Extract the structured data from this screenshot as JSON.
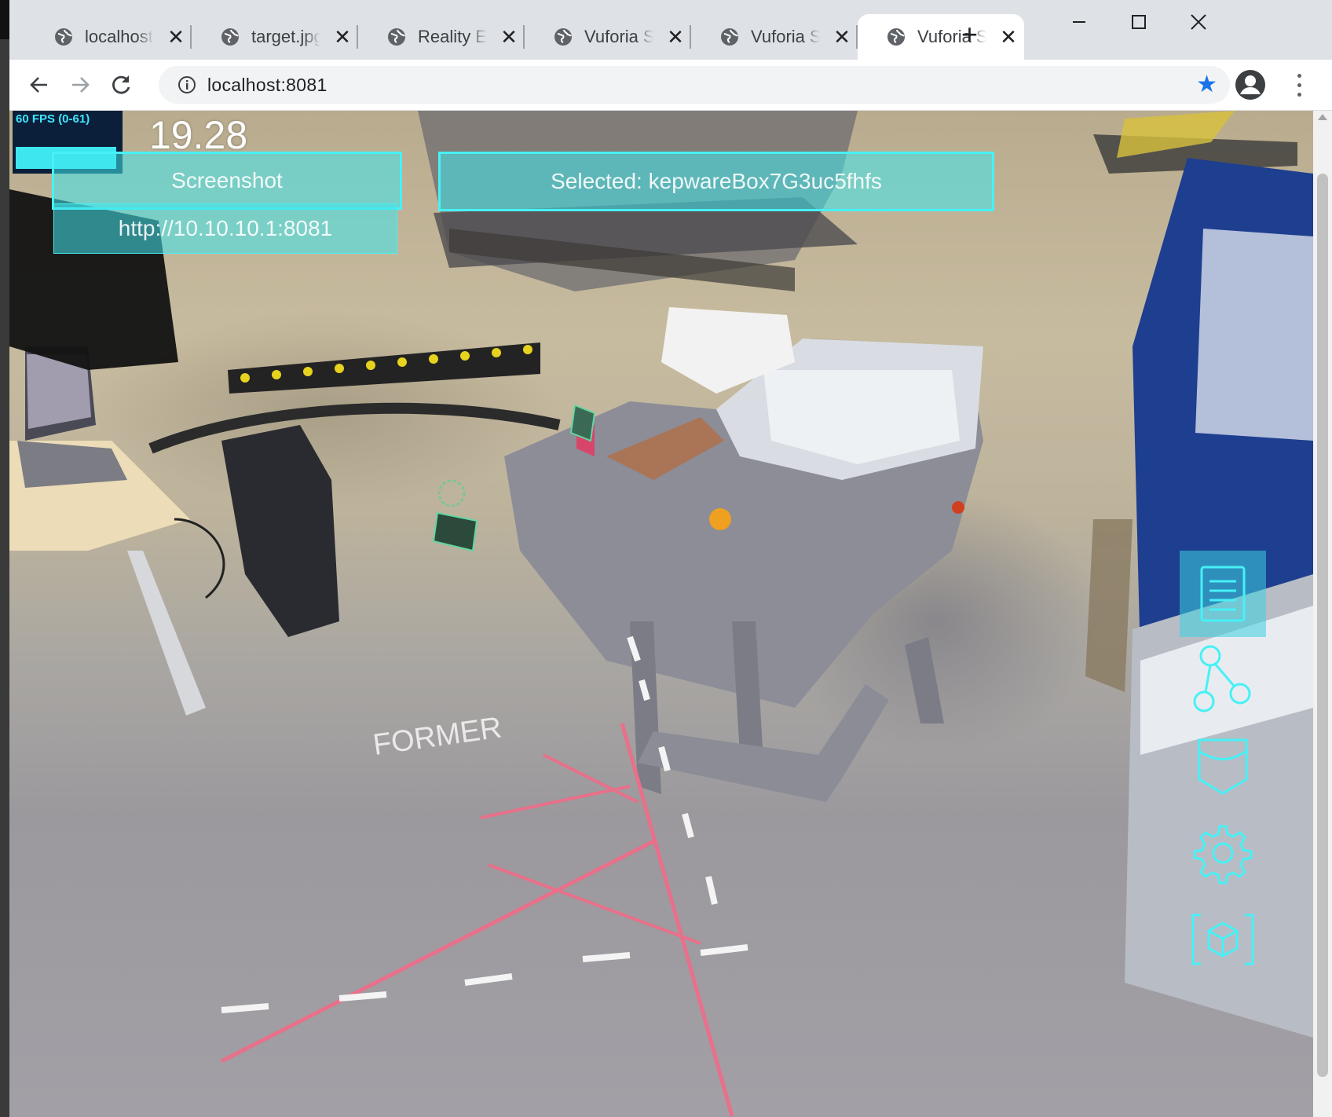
{
  "browser": {
    "tabs": [
      {
        "title": "localhost",
        "active": false
      },
      {
        "title": "target.jpg",
        "active": false
      },
      {
        "title": "Reality Edit",
        "active": false
      },
      {
        "title": "Vuforia Sp",
        "active": false
      },
      {
        "title": "Vuforia Sp",
        "active": false
      },
      {
        "title": "Vuforia Sp",
        "active": true
      }
    ],
    "new_tab_label": "+",
    "address": "localhost:8081",
    "bookmarked": true
  },
  "hud": {
    "fps_label": "60 FPS (0-61)",
    "clock": "19.28",
    "button_top_left": "Screenshot",
    "button_url": "http://10.10.10.1:8081",
    "selected_label": "Selected: kepwareBox7G3uc5fhfs"
  },
  "side_menu": {
    "items": [
      "document-list-icon",
      "graph-nodes-icon",
      "pocket-icon",
      "settings-gear-icon",
      "cube-scan-icon"
    ],
    "active_index": 0
  },
  "scene": {
    "floor_text": "FORMER"
  },
  "colors": {
    "accent": "#47f1f6",
    "star": "#1a73e8",
    "floor_line": "#e8708a"
  }
}
